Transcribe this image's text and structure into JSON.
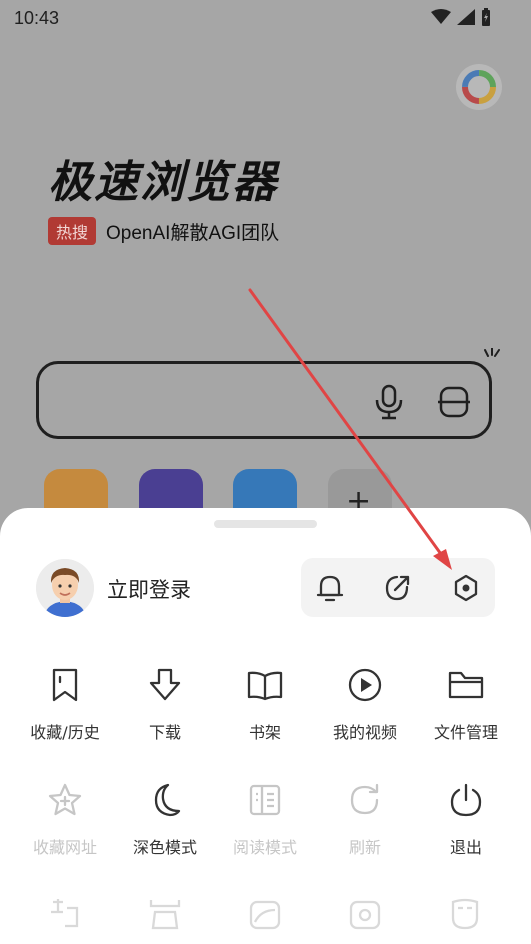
{
  "status_bar": {
    "time": "10:43"
  },
  "home": {
    "brand_title": "极速浏览器",
    "hot_badge": "热搜",
    "hot_text": "OpenAI解散AGI团队"
  },
  "sheet": {
    "login_label": "立即登录",
    "quick_actions": [
      "bell-icon",
      "share-icon",
      "settings-icon"
    ],
    "row1": [
      {
        "label": "收藏/历史",
        "icon": "bookmark-icon",
        "enabled": true
      },
      {
        "label": "下载",
        "icon": "download-icon",
        "enabled": true
      },
      {
        "label": "书架",
        "icon": "book-icon",
        "enabled": true
      },
      {
        "label": "我的视频",
        "icon": "play-icon",
        "enabled": true
      },
      {
        "label": "文件管理",
        "icon": "folder-icon",
        "enabled": true
      }
    ],
    "row2": [
      {
        "label": "收藏网址",
        "icon": "star-add-icon",
        "enabled": false
      },
      {
        "label": "深色模式",
        "icon": "moon-icon",
        "enabled": true
      },
      {
        "label": "阅读模式",
        "icon": "reader-icon",
        "enabled": false
      },
      {
        "label": "刷新",
        "icon": "refresh-icon",
        "enabled": false
      },
      {
        "label": "退出",
        "icon": "power-icon",
        "enabled": true
      }
    ]
  },
  "colors": {
    "accent_red": "#e04545",
    "hot_badge_bg": "#b13a34"
  }
}
